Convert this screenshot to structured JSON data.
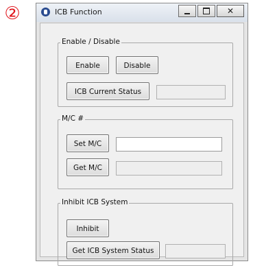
{
  "step_marker": "②",
  "window": {
    "title": "ICB Function",
    "controls": {
      "minimize": "minimize-icon",
      "maximize": "maximize-icon",
      "close": "close-icon"
    }
  },
  "groups": {
    "enable_disable": {
      "label": "Enable / Disable",
      "enable_button": "Enable",
      "disable_button": "Disable",
      "status_button": "ICB Current Status",
      "status_value": ""
    },
    "mc": {
      "label": "M/C #",
      "set_button": "Set M/C",
      "set_value": "",
      "get_button": "Get M/C",
      "get_value": ""
    },
    "inhibit": {
      "label": "Inhibit ICB System",
      "inhibit_button": "Inhibit",
      "status_button": "Get ICB System Status",
      "status_value": ""
    }
  }
}
